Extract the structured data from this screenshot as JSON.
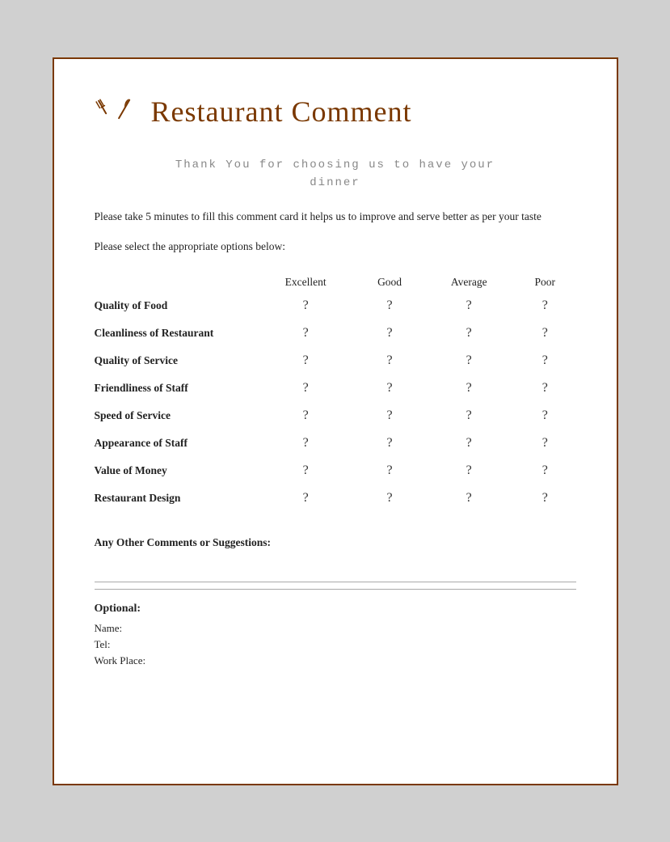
{
  "header": {
    "title": "Restaurant Comment"
  },
  "thank_you": {
    "line1": "Thank You for choosing us to have your",
    "line2": "dinner"
  },
  "description": "Please take 5 minutes to fill this comment card it helps us to improve and serve better as per your taste",
  "instruction": "Please select the appropriate options below:",
  "table": {
    "columns": [
      "",
      "Excellent",
      "Good",
      "Average",
      "Poor"
    ],
    "rows": [
      {
        "label": "Quality of Food"
      },
      {
        "label": "Cleanliness of Restaurant"
      },
      {
        "label": "Quality of Service"
      },
      {
        "label": "Friendliness of Staff"
      },
      {
        "label": "Speed of Service"
      },
      {
        "label": "Appearance of Staff"
      },
      {
        "label": "Value of Money"
      },
      {
        "label": "Restaurant Design"
      }
    ],
    "radio_symbol": "?"
  },
  "comments": {
    "label": "Any Other Comments or Suggestions:"
  },
  "optional": {
    "title": "Optional:",
    "fields": [
      "Name:",
      "Tel:",
      "Work Place:"
    ]
  }
}
